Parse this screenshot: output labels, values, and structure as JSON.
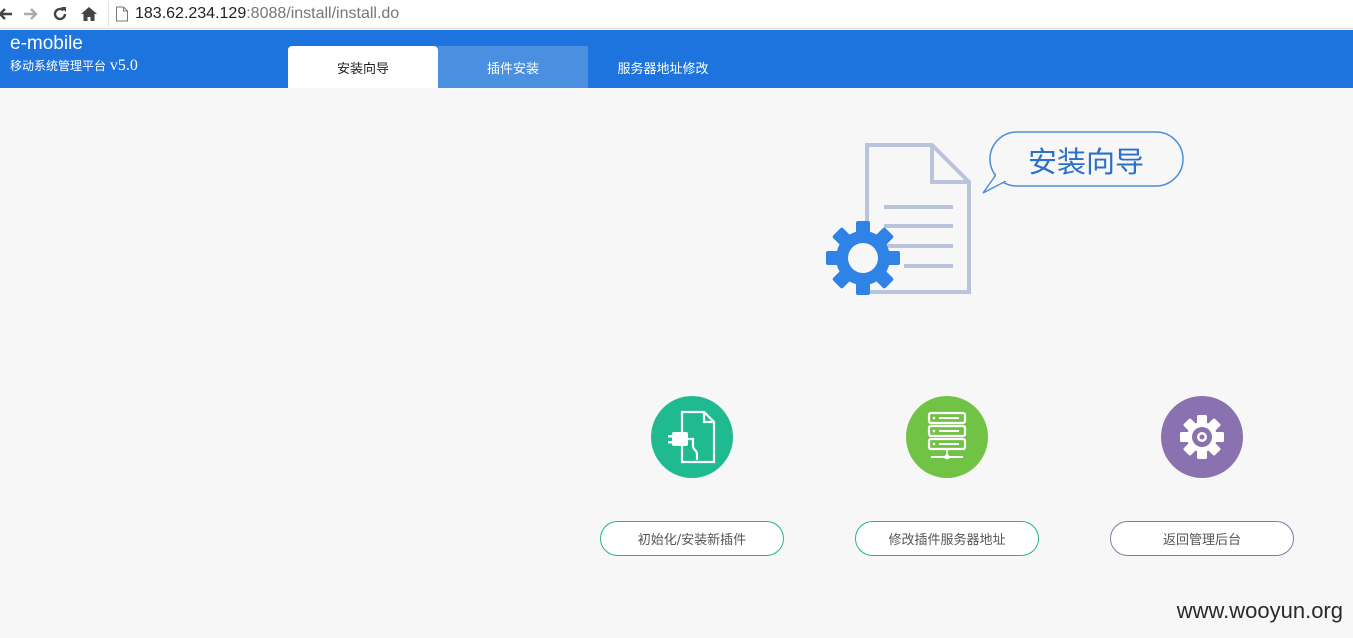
{
  "browser": {
    "url_host": "183.62.234.129",
    "url_rest": ":8088/install/install.do"
  },
  "header": {
    "brand_title": "e-mobile",
    "brand_subtitle": "移动系统管理平台 ",
    "brand_version": "v5.0",
    "tabs": [
      {
        "label": "安装向导",
        "active": true
      },
      {
        "label": "插件安装",
        "active": false
      },
      {
        "label": "服务器地址修改",
        "active": false
      }
    ]
  },
  "hero": {
    "bubble_text": "安装向导"
  },
  "actions": [
    {
      "label": "初始化/安装新插件",
      "icon": "plug-document-icon",
      "color": "#1fba8f",
      "border": "#22b589"
    },
    {
      "label": "修改插件服务器地址",
      "icon": "server-icon",
      "color": "#71c346",
      "border": "#22b589"
    },
    {
      "label": "返回管理后台",
      "icon": "gear-icon",
      "color": "#8a72b0",
      "border": "#8a72b0"
    }
  ],
  "watermark": "www.wooyun.org"
}
